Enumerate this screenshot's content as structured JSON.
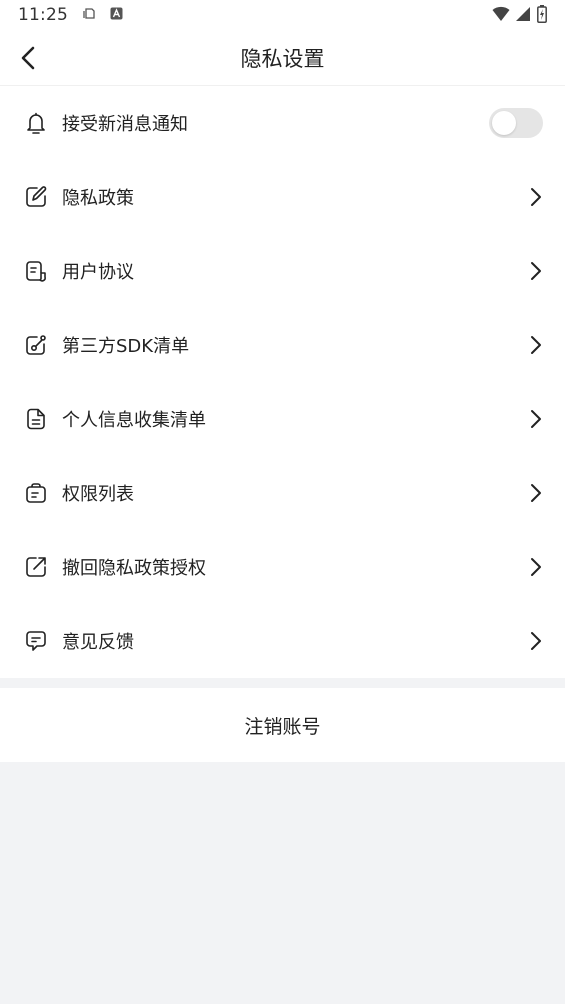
{
  "status_bar": {
    "time": "11:25"
  },
  "header": {
    "title": "隐私设置"
  },
  "settings": {
    "items": [
      {
        "label": "接受新消息通知",
        "icon": "bell-icon",
        "control": "toggle",
        "enabled": false
      },
      {
        "label": "隐私政策",
        "icon": "edit-note-icon",
        "control": "chevron"
      },
      {
        "label": "用户协议",
        "icon": "document-icon",
        "control": "chevron"
      },
      {
        "label": "第三方SDK清单",
        "icon": "link-share-icon",
        "control": "chevron"
      },
      {
        "label": "个人信息收集清单",
        "icon": "file-list-icon",
        "control": "chevron"
      },
      {
        "label": "权限列表",
        "icon": "bag-icon",
        "control": "chevron"
      },
      {
        "label": "撤回隐私政策授权",
        "icon": "external-link-icon",
        "control": "chevron"
      },
      {
        "label": "意见反馈",
        "icon": "chat-icon",
        "control": "chevron"
      }
    ]
  },
  "account": {
    "logout_label": "注销账号"
  },
  "colors": {
    "background": "#f2f3f5",
    "surface": "#ffffff",
    "text": "#222222",
    "toggle_off": "#e5e5e5"
  }
}
